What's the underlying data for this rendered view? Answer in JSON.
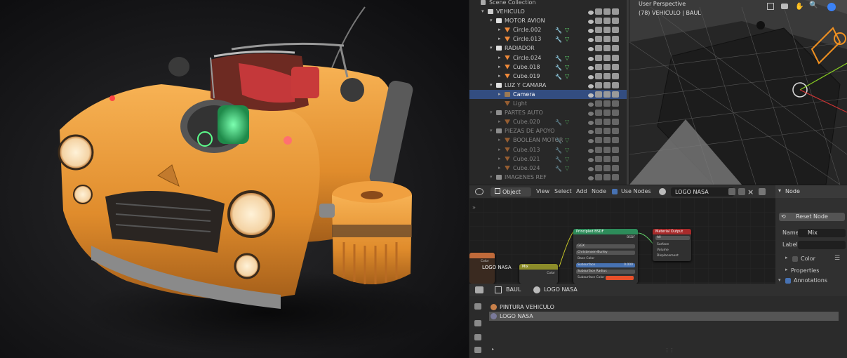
{
  "outliner": {
    "header": "Scene Collection",
    "rows": [
      {
        "label": "VEHICULO",
        "indent": 0,
        "tri": "▾",
        "icon": "scene",
        "dim": false,
        "sel": false,
        "extra": "🏍 ⚫"
      },
      {
        "label": "MOTOR AVION",
        "indent": 1,
        "tri": "▾",
        "icon": "coll",
        "dim": false,
        "sel": false
      },
      {
        "label": "Circle.002",
        "indent": 2,
        "tri": "▸",
        "icon": "mesh",
        "dim": false,
        "sel": false
      },
      {
        "label": "Circle.013",
        "indent": 2,
        "tri": "▸",
        "icon": "mesh",
        "dim": false,
        "sel": false
      },
      {
        "label": "RADIADOR",
        "indent": 1,
        "tri": "▾",
        "icon": "coll",
        "dim": false,
        "sel": false
      },
      {
        "label": "Circle.024",
        "indent": 2,
        "tri": "▸",
        "icon": "mesh",
        "dim": false,
        "sel": false
      },
      {
        "label": "Cube.018",
        "indent": 2,
        "tri": "▸",
        "icon": "mesh",
        "dim": false,
        "sel": false
      },
      {
        "label": "Cube.019",
        "indent": 2,
        "tri": "▸",
        "icon": "mesh",
        "dim": false,
        "sel": false
      },
      {
        "label": "LUZ Y CAMARA",
        "indent": 1,
        "tri": "▾",
        "icon": "coll",
        "dim": false,
        "sel": false
      },
      {
        "label": "Camera",
        "indent": 2,
        "tri": "▸",
        "icon": "cam",
        "dim": false,
        "sel": true
      },
      {
        "label": "Light",
        "indent": 2,
        "tri": "",
        "icon": "light",
        "dim": true,
        "sel": false
      },
      {
        "label": "PARTES AUTO",
        "indent": 1,
        "tri": "▾",
        "icon": "coll",
        "dim": true,
        "sel": false
      },
      {
        "label": "Cube.020",
        "indent": 2,
        "tri": "▸",
        "icon": "mesh",
        "dim": true,
        "sel": false
      },
      {
        "label": "PIEZAS DE APOYO",
        "indent": 1,
        "tri": "▾",
        "icon": "coll",
        "dim": true,
        "sel": false
      },
      {
        "label": "BOOLEAN MOTOR",
        "indent": 2,
        "tri": "▸",
        "icon": "mesh",
        "dim": true,
        "sel": false
      },
      {
        "label": "Cube.013",
        "indent": 2,
        "tri": "▸",
        "icon": "mesh",
        "dim": true,
        "sel": false
      },
      {
        "label": "Cube.021",
        "indent": 2,
        "tri": "▸",
        "icon": "mesh",
        "dim": true,
        "sel": false
      },
      {
        "label": "Cube.024",
        "indent": 2,
        "tri": "▸",
        "icon": "mesh",
        "dim": true,
        "sel": false
      },
      {
        "label": "IMAGENES REF",
        "indent": 1,
        "tri": "▾",
        "icon": "coll",
        "dim": true,
        "sel": false
      }
    ]
  },
  "viewport": {
    "mode": "User Perspective",
    "object": "(78) VEHICULO | BAUL"
  },
  "node_editor": {
    "editor_type": "Object",
    "menus": [
      "View",
      "Select",
      "Add",
      "Node"
    ],
    "use_nodes_label": "Use Nodes",
    "material_name": "LOGO NASA",
    "nodes": {
      "bsdf": {
        "title": "Principled BSDF",
        "out": "BSDF",
        "fields": [
          "GGX",
          "Christensen-Burley",
          "Base Color",
          "Subsurface",
          "Subsurface Radius",
          "Subsurface Color"
        ],
        "subsurface_value": "0.000"
      },
      "output": {
        "title": "Material Output",
        "target": "All",
        "sockets": [
          "Surface",
          "Volume",
          "Displacement"
        ]
      },
      "mix": {
        "title": "Mix",
        "out": "Color"
      },
      "tex": {
        "label": "LOGO NASA",
        "out": "Color"
      }
    }
  },
  "npanel": {
    "section": "Node",
    "reset_label": "Reset Node",
    "name_label": "Name:",
    "name_value": "Mix",
    "label_label": "Label:",
    "color_label": "Color",
    "properties_label": "Properties",
    "annotations_label": "Annotations"
  },
  "properties": {
    "object": "BAUL",
    "material": "LOGO NASA",
    "slots": [
      {
        "name": "PINTURA VEHICULO",
        "color": "#c8804a",
        "active": false
      },
      {
        "name": "LOGO NASA",
        "color": "#7a7a9a",
        "active": true
      }
    ]
  },
  "colors": {
    "selection": "#334d80",
    "accent_orange": "#e8902a",
    "node_green": "#2d8c5a",
    "node_red": "#a82a2a",
    "node_yellow": "#8c8c2a"
  }
}
